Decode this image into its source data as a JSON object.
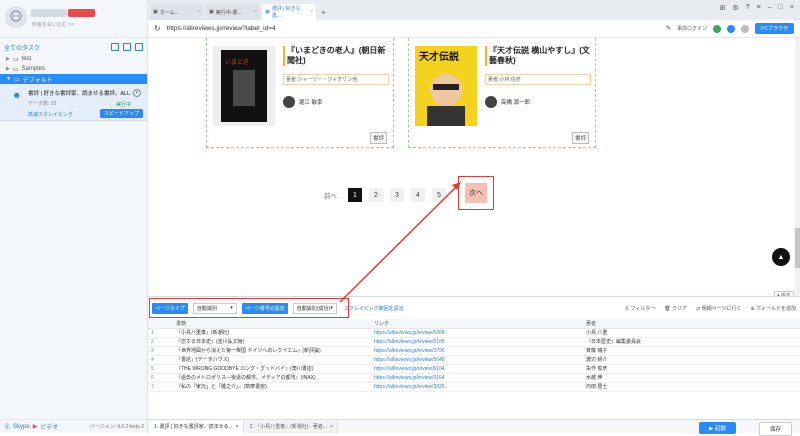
{
  "sidebar": {
    "user_note": "料金を払い込む >>",
    "all_tasks": "全てのタスク",
    "groups": [
      {
        "label": "test"
      },
      {
        "label": "Samples"
      },
      {
        "label": "デフォルト"
      }
    ],
    "task": {
      "title": "書評 | 好きな書評家、読ませる書評。ALL...",
      "data_count": "データ数: 23",
      "status": "実行中",
      "mode": "高速スクレイピング",
      "speedup": "スピードアップ"
    },
    "footer": {
      "s_link": "Skype",
      "video": "ビデオ",
      "version": "バージョン: 4.0.2-beta.2"
    }
  },
  "browser": {
    "tabs": [
      {
        "label": "ホーム..."
      },
      {
        "label": "実行中-書..."
      },
      {
        "label": "書評 | 好きな書..."
      }
    ],
    "url": "https://allreviews.jp/review?label_id=4",
    "pre_login": "事前ログイン",
    "pc_browser": "PCブラウザ"
  },
  "cards": [
    {
      "title": "『いまどきの老人』(朝日新聞社)",
      "author": "著者:シャーリー・ジャクリン他",
      "reviewer": "堀江 敏幸",
      "button": "書評"
    },
    {
      "title": "『天才伝説 横山やすし』(文藝春秋)",
      "author": "著者:小林 信彦",
      "reviewer": "高橋 源一郎",
      "button": "書評"
    }
  ],
  "pager": {
    "prev": "前へ",
    "pages": [
      "1",
      "2",
      "3",
      "4",
      "5"
    ],
    "current": "1",
    "next": "次へ"
  },
  "panel": {
    "page_type_label": "ページタイプ",
    "page_type_value": "自動識別",
    "page_num_label": "ページ番号の設定",
    "page_num_value": "自動識別(成功)",
    "scrape_range": "スクレイピング範囲を設定",
    "tools": [
      "フィルター",
      "クリア",
      "明細ページに行く",
      "フィールドを追加"
    ],
    "fold": "折る",
    "headers": [
      "",
      "書籍",
      "リンク",
      "著者"
    ],
    "rows": [
      {
        "n": "1",
        "book": "『小鳥八重奏』(新潮社)",
        "link": "https://allreviews.jp/review/5268",
        "author": "小鳥 八重"
      },
      {
        "n": "2",
        "book": "『恋する日本史』(吉川弘文館)",
        "link": "https://allreviews.jp/review/5165",
        "author": "『日本歴史』編集委員会"
      },
      {
        "n": "3",
        "book": "『世界地図から消えた第一帝国 ドイツへのレクイエム』(新評論)",
        "link": "https://allreviews.jp/review/3796",
        "author": "斉藤 瑞子"
      },
      {
        "n": "4",
        "book": "『書店』(データハウス)",
        "link": "https://allreviews.jp/review/5648",
        "author": "渡辺 絵介"
      },
      {
        "n": "5",
        "book": "『THE WRONG GOODBYE ロング・グッドバイ』(角川書店)",
        "link": "https://allreviews.jp/review/6104",
        "author": "矢作 俊彦"
      },
      {
        "n": "6",
        "book": "『過去のメトロポリス―後退の都市、メディアの都市』(INAX)",
        "link": "https://allreviews.jp/review/3164",
        "author": "水越 伸"
      },
      {
        "n": "7",
        "book": "『私の「家元」と「雛之介」』(筑摩書房)",
        "link": "https://allreviews.jp/review/3925",
        "author": "内田 居士"
      }
    ]
  },
  "bottom": {
    "tabs": [
      "1. 書評 | 好きな書評家、読ませる...",
      "2. 『小鳥八重奏』(新潮社) - 著者..."
    ],
    "run": "起動",
    "save": "保存"
  },
  "colors": {
    "accent": "#2a8af6",
    "highlight": "#e53935"
  }
}
